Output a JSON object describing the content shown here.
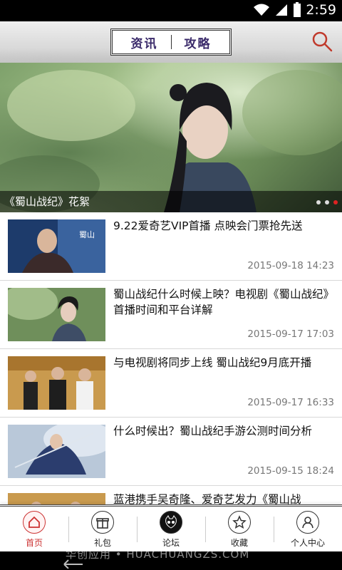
{
  "status_bar": {
    "time": "2:59"
  },
  "header": {
    "tabs": [
      {
        "label": "资讯"
      },
      {
        "label": "攻略"
      }
    ]
  },
  "banner": {
    "caption": "《蜀山战纪》花絮",
    "dot_count": 3,
    "active_dot": 3
  },
  "news": [
    {
      "title": "9.22爱奇艺VIP首播 点映会门票抢先送",
      "date": "2015-09-18 14:23"
    },
    {
      "title": "蜀山战纪什么时候上映？电视剧《蜀山战纪》首播时间和平台详解",
      "date": "2015-09-17 17:03"
    },
    {
      "title": "与电视剧将同步上线 蜀山战纪9月底开播",
      "date": "2015-09-17 16:33"
    },
    {
      "title": "什么时候出？蜀山战纪手游公测时间分析",
      "date": "2015-09-15 18:24"
    },
    {
      "title": "蓝港携手吴奇隆、爱奇艺发力《蜀山战",
      "date": ""
    }
  ],
  "bottom_nav": [
    {
      "label": "首页",
      "icon": "home-icon",
      "active": true
    },
    {
      "label": "礼包",
      "icon": "gift-icon",
      "active": false
    },
    {
      "label": "论坛",
      "icon": "cat-face-icon",
      "active": false
    },
    {
      "label": "收藏",
      "icon": "star-icon",
      "active": false
    },
    {
      "label": "个人中心",
      "icon": "user-icon",
      "active": false
    }
  ],
  "watermark": "华创应用 • HUACHUANGZS.COM",
  "colors": {
    "accent": "#cc3333",
    "tab_text": "#3a2a6a"
  }
}
